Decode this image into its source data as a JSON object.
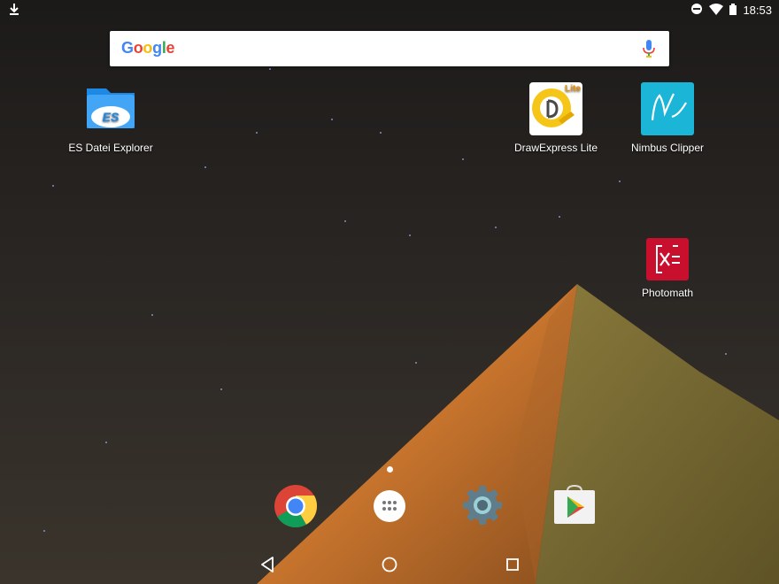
{
  "status_bar": {
    "time": "18:53",
    "icons": [
      "download-icon",
      "do-not-disturb-icon",
      "wifi-icon",
      "battery-icon"
    ]
  },
  "search": {
    "logo": "Google",
    "icons": [
      "mic-icon"
    ]
  },
  "apps": [
    {
      "label": "ES Datei Explorer",
      "icon": "es-file-explorer-icon"
    },
    {
      "label": "DrawExpress Lite",
      "icon": "drawexpress-icon",
      "badge": "Lite"
    },
    {
      "label": "Nimbus Clipper",
      "icon": "nimbus-clipper-icon"
    },
    {
      "label": "Photomath",
      "icon": "photomath-icon"
    }
  ],
  "dock": [
    "chrome-icon",
    "app-drawer-icon",
    "settings-icon",
    "play-store-icon"
  ],
  "nav": [
    "back-icon",
    "home-icon",
    "recents-icon"
  ],
  "colors": {
    "google_blue": "#4285F4",
    "google_red": "#EA4335",
    "google_yellow": "#FBBC05",
    "google_green": "#34A853",
    "photomath_red": "#C8102E",
    "nimbus_teal": "#1BB5D8"
  }
}
